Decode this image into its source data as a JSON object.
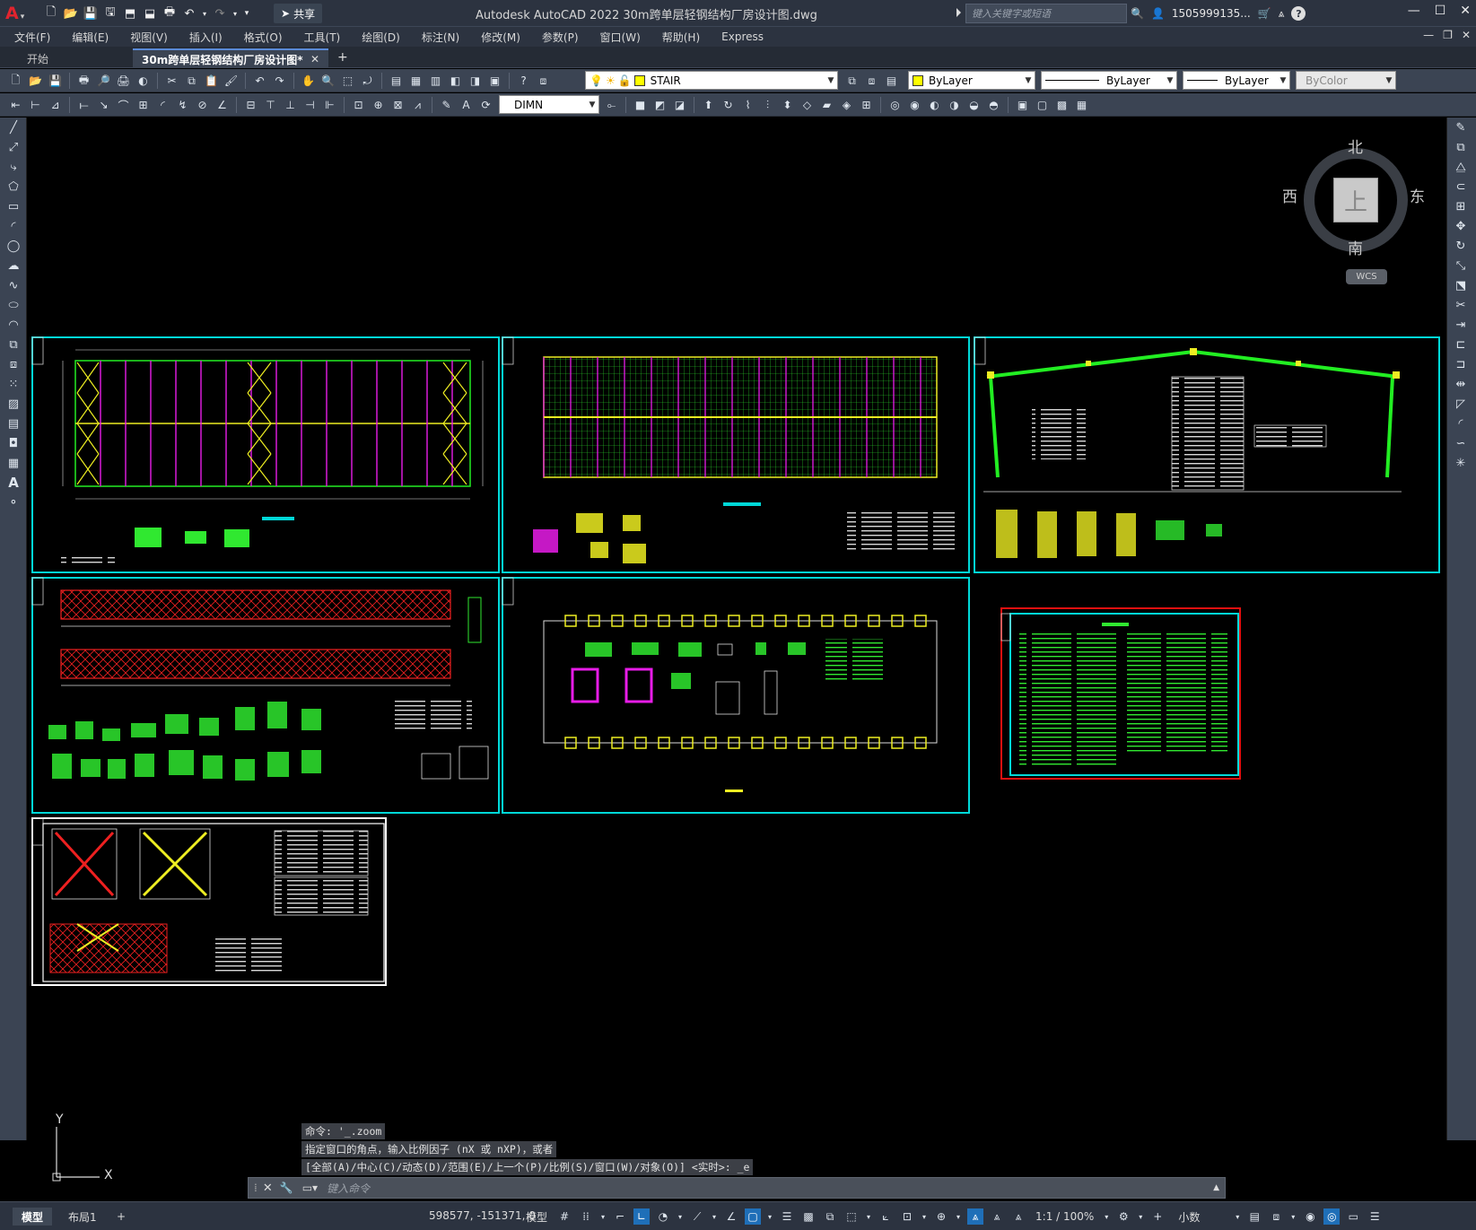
{
  "app": {
    "window_title": "Autodesk AutoCAD 2022    30m跨单层轻钢结构厂房设计图.dwg",
    "logo": "A",
    "share_label": "共享",
    "search_placeholder": "键入关键字或短语",
    "user_name": "1505999135...",
    "help_label": "?"
  },
  "menu": {
    "items": [
      "文件(F)",
      "编辑(E)",
      "视图(V)",
      "插入(I)",
      "格式(O)",
      "工具(T)",
      "绘图(D)",
      "标注(N)",
      "修改(M)",
      "参数(P)",
      "窗口(W)",
      "帮助(H)",
      "Express"
    ]
  },
  "tabs": {
    "start": "开始",
    "active": "30m跨单层轻钢结构厂房设计图*",
    "close": "✕",
    "add": "+"
  },
  "toolbar": {
    "layer_name": "STAIR",
    "color": "ByLayer",
    "linetype": "ByLayer",
    "lineweight": "ByLayer",
    "plotstyle": "ByColor",
    "dimstyle": "DIMN",
    "layer_color": "#ffff00"
  },
  "viewcube": {
    "north": "北",
    "south": "南",
    "east": "东",
    "west": "西",
    "top": "上",
    "wcs": "WCS"
  },
  "command": {
    "history": [
      "命令: '_.zoom",
      "指定窗口的角点，输入比例因子 (nX 或 nXP)，或者",
      "[全部(A)/中心(C)/动态(D)/范围(E)/上一个(P)/比例(S)/窗口(W)/对象(O)] <实时>: _e"
    ],
    "placeholder": "键入命令"
  },
  "ucs": {
    "x": "X",
    "y": "Y"
  },
  "status": {
    "model_tab": "模型",
    "layout_tab": "布局1",
    "add_tab": "+",
    "coordinates": "598577, -151371, 0",
    "model_label": "模型",
    "scale": "1:1 / 100%",
    "units": "小数"
  },
  "colors": {
    "cyan_border": "#00d8d8",
    "white_border": "#ffffff",
    "red_border": "#e01010",
    "green_line": "#22ee22",
    "magenta": "#e81ce8",
    "yellow": "#eeee22",
    "red": "#ee2020"
  }
}
